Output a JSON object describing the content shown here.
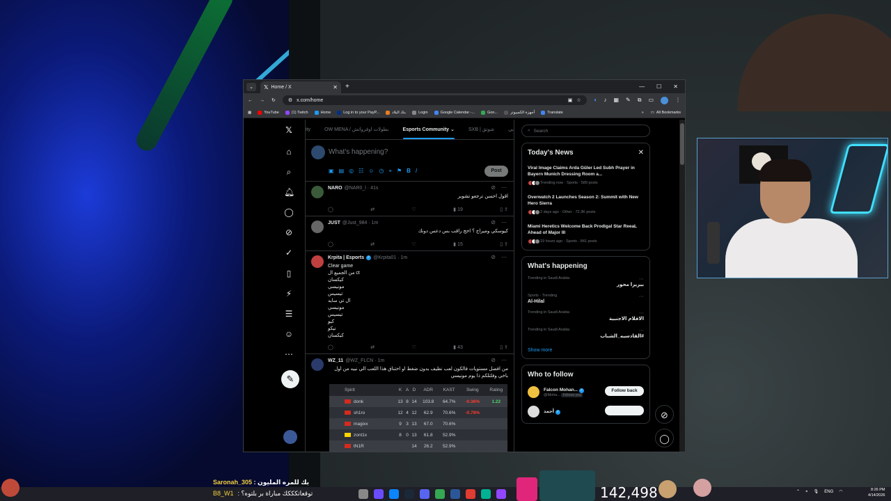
{
  "browser": {
    "tab_title": "Home / X",
    "url": "x.com/home",
    "bookmarks": [
      {
        "label": "YouTube",
        "color": "#ff0000"
      },
      {
        "label": "(1) Twitch",
        "color": "#9146ff"
      },
      {
        "label": "Home",
        "color": "#1d9bf0"
      },
      {
        "label": "Log in to your PayP...",
        "color": "#003087"
      },
      {
        "label": "بنك البلاد",
        "color": "#e67e22"
      },
      {
        "label": "Login",
        "color": "#888888"
      },
      {
        "label": "Google Calendar -...",
        "color": "#4285f4"
      },
      {
        "label": "Goo...",
        "color": "#34a853"
      },
      {
        "label": "أجهزة الكمبيوتر",
        "color": "#555555"
      },
      {
        "label": "Translate",
        "color": "#4285f4"
      }
    ],
    "all_bookmarks": "All Bookmarks"
  },
  "x": {
    "community_tabs": [
      "ity",
      "OW MENA / بطولات اوفرواتش",
      "Esports Community",
      "SXB | شوتق",
      "بي"
    ],
    "composer_placeholder": "What's happening?",
    "post_label": "Post",
    "tweets": [
      {
        "name": "NARO",
        "handle": "@NAR0_l · 41s",
        "text": "اقول احسن ترجعو تشوبر",
        "views": "19",
        "verified": false
      },
      {
        "name": "JUST",
        "handle": "@Just_984 · 1m",
        "text": "كيوسكي وميراج ؟ اخج راقب بس دعس دونك",
        "views": "15",
        "verified": false
      },
      {
        "name": "Krpita | Esports",
        "handle": "@Krpita01 · 1m",
        "text": "Clear game\nمن الجميع ال ct\nكيكسان\nمونيسي\nتيسيس\nال تي سايد\nمونيسي\nتيسيس\nكيو\nنيكو\nكيكسان",
        "views": "43",
        "verified": true
      },
      {
        "name": "WZ_11",
        "handle": "@WZ_FLCN · 1m",
        "text": "من افضل مستويات فالكون لعب نظيف بدون ضغط او اختناق هذا اللعب الي نبيه من اول باخي وفلتلكم ذا يوم مونيسي",
        "views": "",
        "verified": false
      }
    ],
    "stats_table": {
      "team": "Spirit",
      "headers": [
        "K",
        "A",
        "D",
        "ADR",
        "KAST",
        "Swing",
        "Rating"
      ],
      "rows": [
        {
          "player": "donk",
          "flag": "#d52b1e",
          "k": "13",
          "a": "8",
          "d": "14",
          "adr": "103.8",
          "kast": "64.7%",
          "swing": "-0.36%",
          "rating": "1.22",
          "rating_class": "pos"
        },
        {
          "player": "sh1ro",
          "flag": "#d52b1e",
          "k": "12",
          "a": "4",
          "d": "12",
          "adr": "62.9",
          "kast": "70.6%",
          "swing": "-0.78%",
          "rating": "",
          "rating_class": "neg"
        },
        {
          "player": "magixx",
          "flag": "#d52b1e",
          "k": "9",
          "a": "3",
          "d": "13",
          "adr": "67.0",
          "kast": "70.6%",
          "swing": "",
          "rating": "",
          "rating_class": "neg"
        },
        {
          "player": "zont1x",
          "flag": "#ffd500",
          "k": "8",
          "a": "0",
          "d": "13",
          "adr": "61.8",
          "kast": "52.9%",
          "swing": "",
          "rating": "",
          "rating_class": "neg"
        },
        {
          "player": "tN1R",
          "flag": "#d52b1e",
          "k": "",
          "a": "",
          "d": "14",
          "adr": "26.2",
          "kast": "52.9%",
          "swing": "",
          "rating": "",
          "rating_class": "neg"
        }
      ]
    },
    "search_placeholder": "Search",
    "todays_news": {
      "title": "Today's News",
      "items": [
        {
          "headline": "Viral Image Claims Arda Güler Led Subh Prayer in Bayern Munich Dressing Room a...",
          "meta": "Trending now · Sports · 589 posts"
        },
        {
          "headline": "Overwatch 2 Launches Season 2: Summit with New Hero Sierra",
          "meta": "2 days ago · Other · 72.3K posts"
        },
        {
          "headline": "Miami Heretics Welcome Back Prodigal Star ReeaL Ahead of Major III",
          "meta": "19 hours ago · Sports · 841 posts"
        }
      ]
    },
    "whats_happening": {
      "title": "What's happening",
      "trends": [
        {
          "context": "Trending in Saudi Arabia",
          "name": "بيريرا محور",
          "rtl": true
        },
        {
          "context": "Sports · Trending",
          "name": "Al-Hilal",
          "rtl": false
        },
        {
          "context": "Trending in Saudi Arabia",
          "name": "الافلام الاجنبية",
          "rtl": true
        },
        {
          "context": "Trending in Saudi Arabia",
          "name": "#القادسيه_الشباب",
          "rtl": true
        }
      ],
      "show_more": "Show more"
    },
    "who_to_follow": {
      "title": "Who to follow",
      "accounts": [
        {
          "name": "Falcon Mohan...",
          "handle": "@Moha...",
          "follows_you": "Follows you",
          "button": "Follow back"
        },
        {
          "name": "أحمد",
          "handle": "",
          "follows_you": "",
          "button": ""
        }
      ]
    }
  },
  "stream": {
    "chat_line1_name": "Saronah_305",
    "chat_line1_text": ": بك للمره المليون",
    "chat_line2_name": "B8_W1",
    "chat_line2_text": ": توقعاتكككك مباراة بر بلتوه؟",
    "viewer_count": "142,498",
    "clock_time": "8:26 PM",
    "clock_date": "4/14/2026",
    "language": "ENG"
  }
}
